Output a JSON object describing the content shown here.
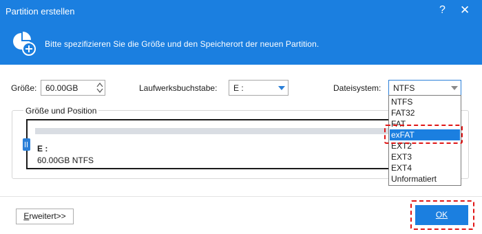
{
  "window": {
    "title": "Partition erstellen",
    "help_label": "?",
    "close_label": "✕"
  },
  "header": {
    "icon": "partition-add-icon",
    "text": "Bitte spezifizieren Sie die Größe und den Speicherort der neuen Partition."
  },
  "form": {
    "size_label": "Größe:",
    "size_value": "60.00GB",
    "drive_letter_label": "Laufwerksbuchstabe:",
    "drive_letter_value": "E :",
    "filesystem_label": "Dateisystem:",
    "filesystem_value": "NTFS"
  },
  "position_group": {
    "title": "Größe und Position",
    "partition_letter": "E :",
    "partition_info": "60.00GB NTFS"
  },
  "filesystem_dropdown": {
    "options": [
      "NTFS",
      "FAT32",
      "FAT",
      "exFAT",
      "EXT2",
      "EXT3",
      "EXT4",
      "Unformatiert"
    ],
    "highlighted": "exFAT"
  },
  "footer": {
    "advanced_label": "Erweitert>>",
    "ok_label": "OK"
  },
  "colors": {
    "accent": "#1b7fe0",
    "highlight_outline": "#e01414"
  }
}
